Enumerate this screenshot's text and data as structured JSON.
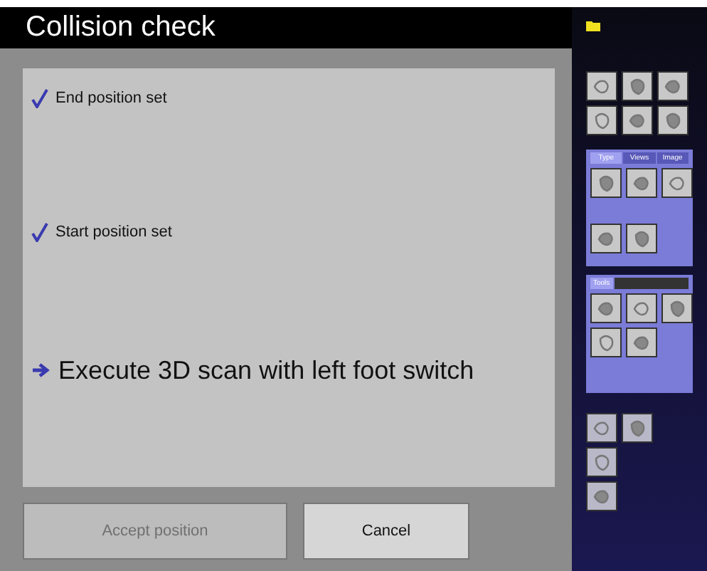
{
  "dialog": {
    "title": "Collision check",
    "steps": [
      {
        "kind": "done",
        "text": "End position set"
      },
      {
        "kind": "done",
        "text": "Start position set"
      },
      {
        "kind": "next",
        "text": "Execute 3D scan with left foot switch"
      }
    ],
    "buttons": [
      {
        "label": "Accept position",
        "disabled": true
      },
      {
        "label": "Cancel",
        "disabled": false
      }
    ]
  },
  "sidebar": {
    "groups": [
      {
        "tabs": [
          {
            "label": "Type",
            "selected": true
          },
          {
            "label": "Views",
            "selected": false
          },
          {
            "label": "Image",
            "selected": false
          }
        ]
      },
      {
        "tabs": [
          {
            "label": "Tools",
            "selected": true
          }
        ]
      }
    ]
  }
}
